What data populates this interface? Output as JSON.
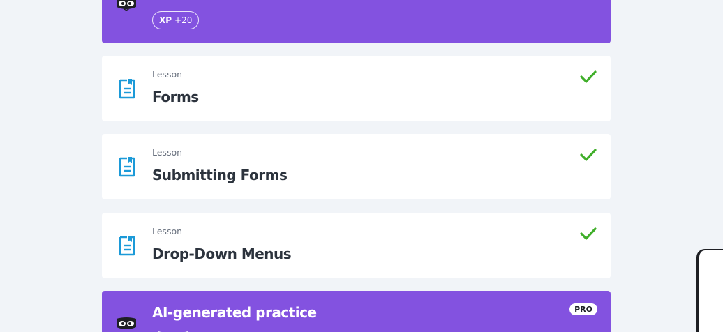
{
  "top_card": {
    "xp_label": "XP",
    "xp_value": "+20",
    "color": "#8352e0"
  },
  "lessons": [
    {
      "kicker": "Lesson",
      "title": "Forms",
      "completed": true,
      "icon": "lesson-document-icon"
    },
    {
      "kicker": "Lesson",
      "title": "Submitting Forms",
      "completed": true,
      "icon": "lesson-document-icon"
    },
    {
      "kicker": "Lesson",
      "title": "Drop-Down Menus",
      "completed": true,
      "icon": "lesson-document-icon"
    }
  ],
  "ai_practice": {
    "title": "AI-generated practice",
    "badge": "PRO",
    "color": "#8352e0"
  },
  "colors": {
    "accent_purple": "#8352e0",
    "check_green": "#3fae29",
    "lesson_icon_blue": "#1c9ad8",
    "background": "#f1f4f8"
  }
}
